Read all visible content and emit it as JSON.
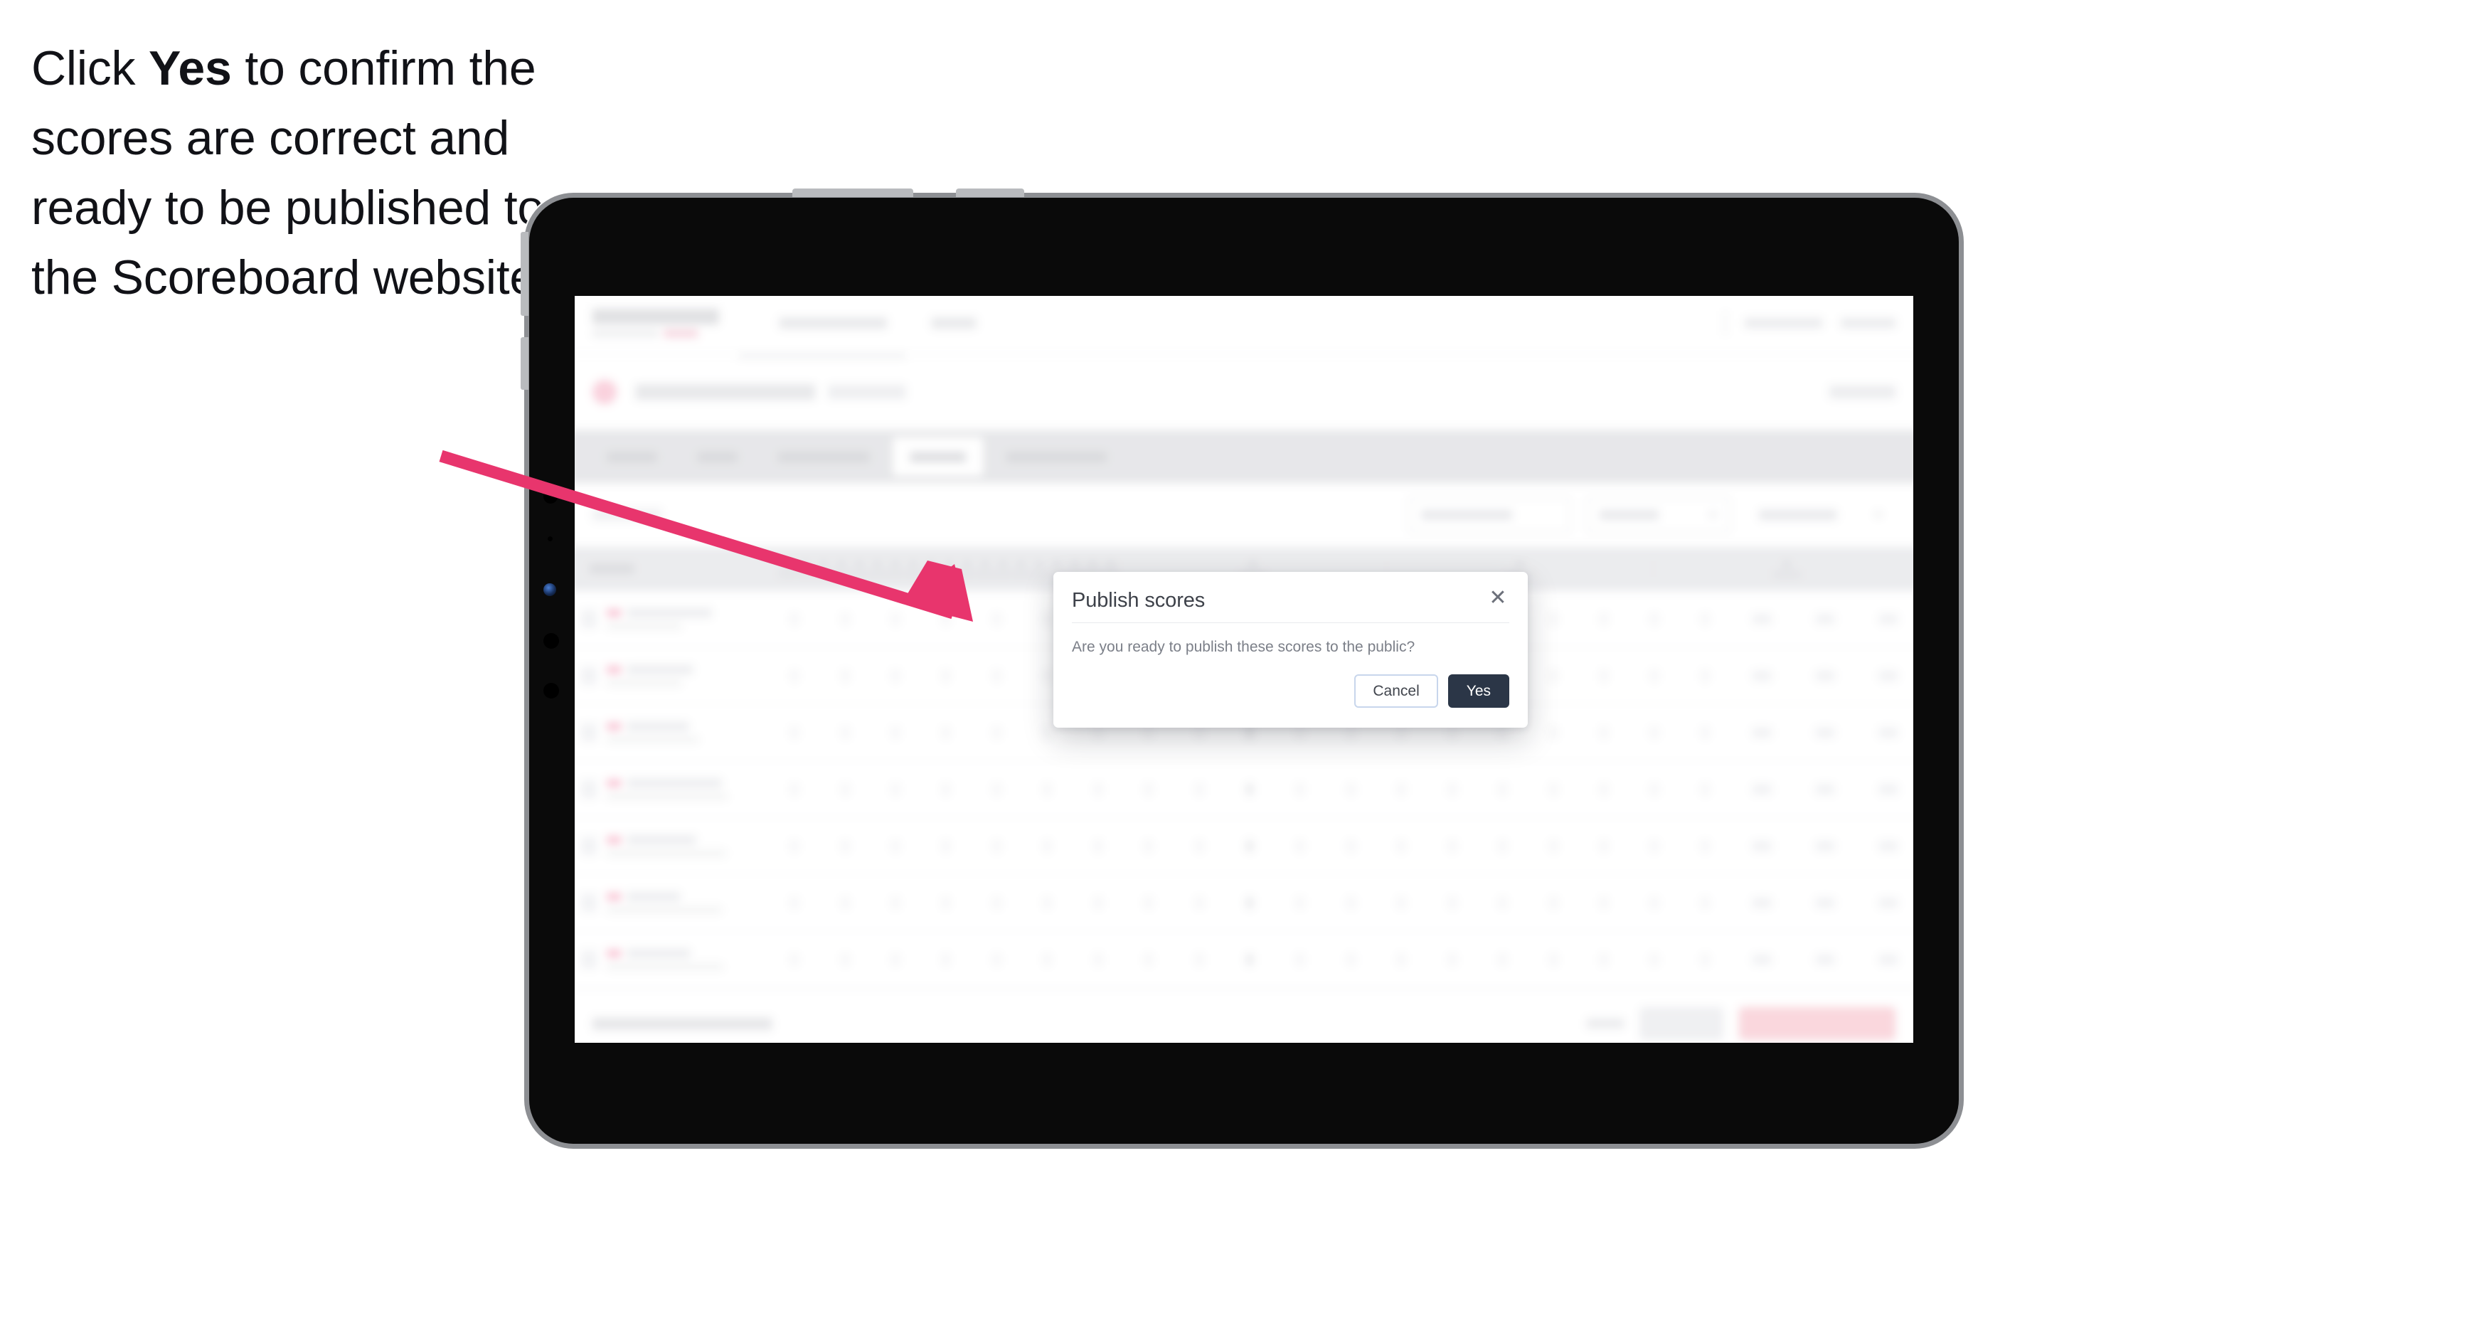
{
  "caption": {
    "before": "Click ",
    "emphasis": "Yes",
    "after": " to confirm the scores are correct and ready to be published to the Scoreboard website."
  },
  "colors": {
    "arrow": "#E8356D",
    "primary_button": "#2B3647",
    "cancel_border": "#C8D6EC",
    "accent_pink": "#F0537D",
    "tabbar_bg": "#D4D5D9",
    "table_header_bg": "#DCDDE1",
    "publish_button": "#F6B8C3"
  },
  "modal": {
    "title": "Publish scores",
    "body": "Are you ready to publish these scores to the public?",
    "close_icon": "close-icon",
    "cancel_label": "Cancel",
    "confirm_label": "Yes"
  },
  "device": {
    "type": "tablet",
    "orientation": "landscape"
  },
  "app": {
    "header": {
      "logo": "SCOREBOARD",
      "nav": [
        "Tournaments",
        "Sport"
      ],
      "account": [
        "Get Help",
        "Name"
      ]
    },
    "event": {
      "title": "Event Invitational",
      "badge": "2023",
      "right_action": "Event ID"
    },
    "tabs": [
      {
        "label": "Details",
        "active": false
      },
      {
        "label": "Teams",
        "active": false
      },
      {
        "label": "Scorecards",
        "active": false
      },
      {
        "label": "Results",
        "active": true
      },
      {
        "label": "Leaderboard",
        "active": false
      }
    ],
    "filters": [
      {
        "label": "Filter by team"
      },
      {
        "label": "Round"
      },
      {
        "label": "Table view"
      }
    ],
    "table": {
      "player_column": "Player",
      "hole_columns": [
        "1",
        "2",
        "3",
        "4",
        "5",
        "6",
        "7",
        "8",
        "9",
        "Out",
        "10",
        "11",
        "12",
        "13",
        "14",
        "15",
        "16",
        "17",
        "18"
      ],
      "summary_columns": [
        "In",
        "Total",
        "Score"
      ],
      "rows": [
        {
          "name": "Player One",
          "club": "Club Name"
        },
        {
          "name": "Player Two",
          "club": "Club Name"
        },
        {
          "name": "Player Three",
          "club": "Club Name"
        },
        {
          "name": "Player Four",
          "club": "Club Name"
        },
        {
          "name": "Player Five",
          "club": "Club Name"
        },
        {
          "name": "Player Six",
          "club": "Club Name"
        },
        {
          "name": "Player Seven",
          "club": "Club Name"
        }
      ]
    },
    "action_bar": {
      "status": "Results confirmed successfully",
      "link_label": "Cancel",
      "secondary_label": "Save",
      "primary_label": "Publish to Scoreboard"
    }
  }
}
